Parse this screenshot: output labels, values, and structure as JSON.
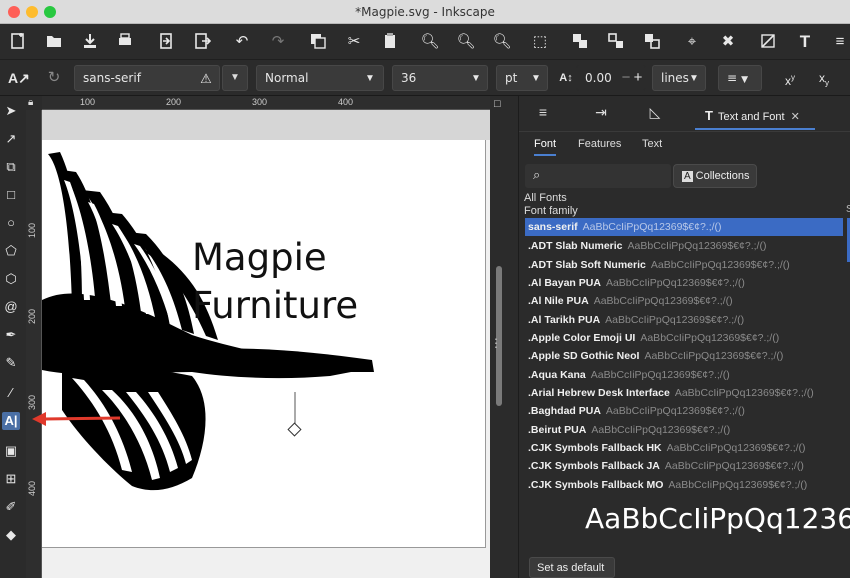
{
  "window": {
    "title": "*Magpie.svg - Inkscape"
  },
  "controls": {
    "font_family": "sans-serif",
    "font_style": "Normal",
    "font_size": "36",
    "unit": "pt",
    "line_spacing": "0.00",
    "line_unit": "lines"
  },
  "rulers": {
    "h": [
      "100",
      "200",
      "300",
      "400"
    ],
    "v": [
      "100",
      "200",
      "300",
      "400"
    ]
  },
  "canvas": {
    "title_line1": "Magpie",
    "title_line2": "Furniture"
  },
  "panel": {
    "active_tab": "Text and Font",
    "subtabs": [
      "Font",
      "Features",
      "Text"
    ],
    "collections": "Collections",
    "all_fonts": "All Fonts",
    "font_family_label": "Font family",
    "sample": "AaBbCcIiPpQq12369$€¢?.;/()",
    "fonts": [
      "sans-serif",
      ".ADT Slab Numeric",
      ".ADT Slab Soft Numeric",
      ".Al Bayan PUA",
      ".Al Nile PUA",
      ".Al Tarikh PUA",
      ".Apple Color Emoji UI",
      ".Apple SD Gothic NeoI",
      ".Aqua Kana",
      ".Arial Hebrew Desk Interface",
      ".Baghdad PUA",
      ".Beirut PUA",
      ".CJK Symbols Fallback HK",
      ".CJK Symbols Fallback JA",
      ".CJK Symbols Fallback MO"
    ],
    "preview": "AaBbCcIiPpQq1236",
    "set_default": "Set as default",
    "edge_label": "S"
  },
  "colors": {
    "accent": "#3b6bc4",
    "arrow": "#e0392b"
  }
}
